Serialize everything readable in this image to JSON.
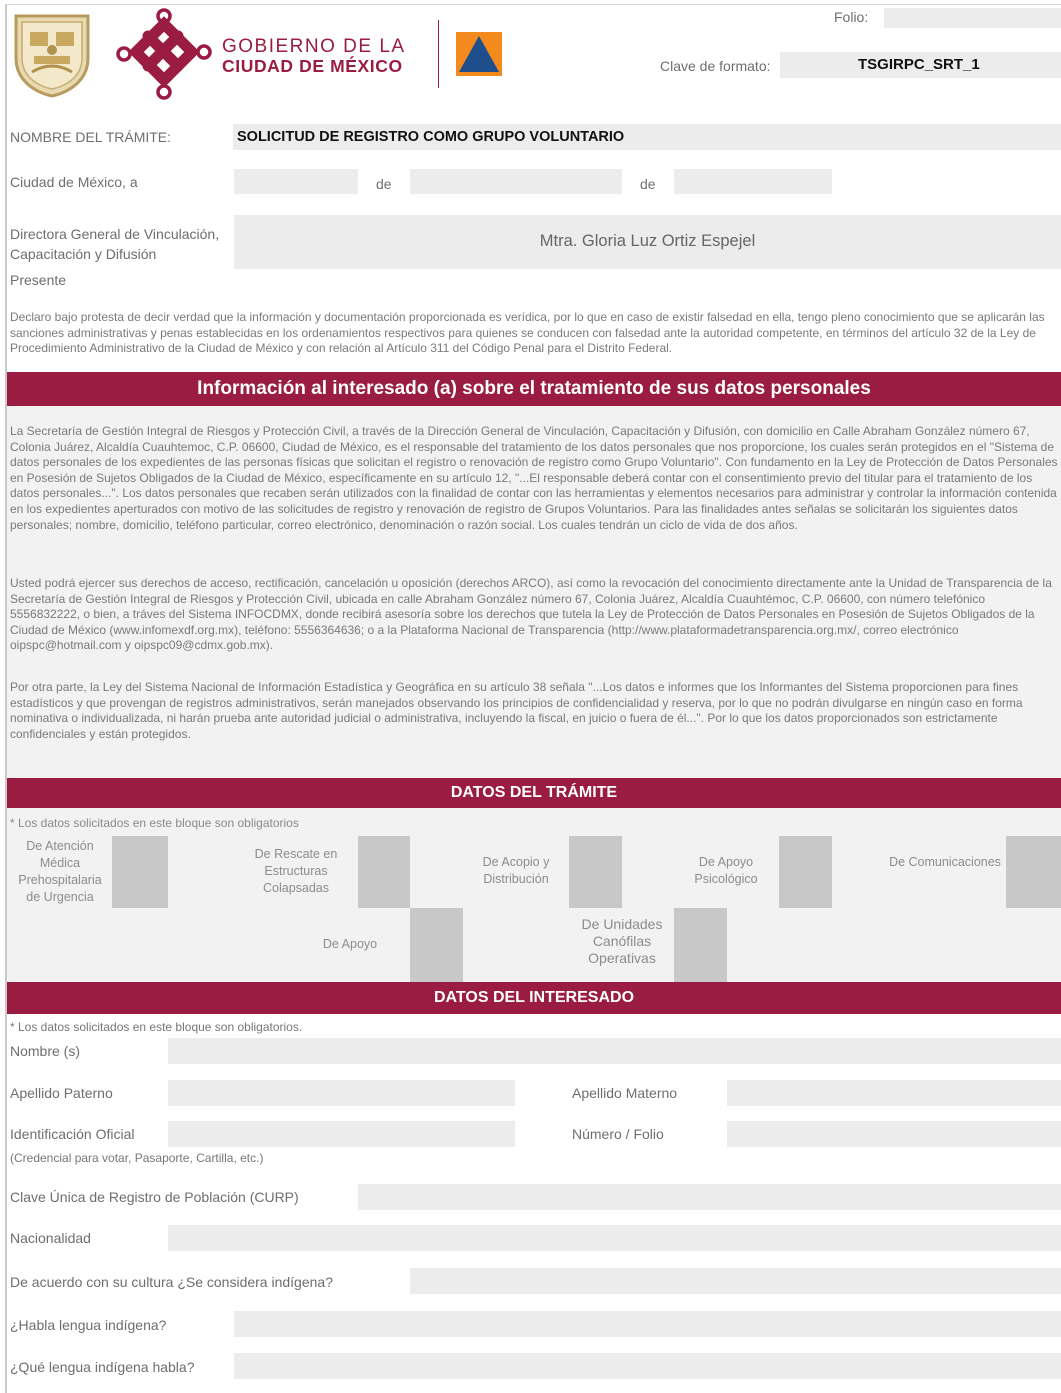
{
  "header": {
    "folio_label": "Folio:",
    "brand_line1": "GOBIERNO DE LA",
    "brand_line2": "CIUDAD DE MÉXICO",
    "clave_label": "Clave de formato:",
    "clave_value": "TSGIRPC_SRT_1",
    "colors": {
      "brand": "#9b1c42",
      "banner": "#9b1c42",
      "civil_protection_blue": "#1f4e8c",
      "civil_protection_orange": "#f28a1e"
    }
  },
  "tramite": {
    "nombre_label": "NOMBRE DEL TRÁMITE:",
    "nombre_value": "SOLICITUD DE REGISTRO COMO GRUPO VOLUNTARIO",
    "ciudad_label": "Ciudad de México, a",
    "de1": "de",
    "de2": "de",
    "directora_label": "Directora General de Vinculación, Capacitación y Difusión",
    "directora_value": "Mtra. Gloria Luz Ortiz Espejel",
    "presente": "Presente",
    "declaro": "Declaro bajo protesta de decir verdad que la información y documentación proporcionada es verídica, por lo que en caso de existir falsedad en ella, tengo pleno conocimiento que se aplicarán las sanciones administrativas y penas establecidas en los ordenamientos respectivos para quienes se conducen con falsedad ante la autoridad competente, en términos del artículo 32 de la Ley de Procedimiento Administrativo de la Ciudad de México y con relación al Artículo 311 del Código Penal para el Distrito Federal."
  },
  "info": {
    "title": "Información al interesado (a) sobre el tratamiento de sus datos personales",
    "p1": "La Secretaría de Gestión Integral de Riesgos y Protección Civil, a través de la Dirección General de Vinculación, Capacitación y Difusión, con domicilio en Calle Abraham González número 67, Colonia Juárez, Alcaldía Cuauhtemoc, C.P. 06600, Ciudad de México, es el responsable del tratamiento de los datos personales que nos proporcione, los cuales serán protegidos en el \"Sistema de datos personales de los expedientes de las personas físicas que solicitan el registro o renovación de registro como Grupo Voluntario\". Con fundamento en la Ley de Protección de Datos Personales en Posesión de Sujetos Obligados de la Ciudad de México, específicamente en su artículo 12, \"...El responsable deberá contar con el consentimiento previo del titular para el tratamiento de los datos personales...\". Los datos personales que recaben serán utilizados con la finalidad de contar con las herramientas y elementos necesarios para administrar y controlar la información contenida en los expedientes aperturados con motivo de las solicitudes de registro y renovación de registro de Grupos Voluntarios. Para las finalidades antes señalas se solicitarán los siguientes datos personales; nombre, domicilio, teléfono particular, correo electrónico, denominación o razón social. Los cuales tendrán un ciclo de vida de dos años.",
    "p2": "Usted podrá ejercer sus derechos de acceso, rectificación, cancelación u oposición (derechos ARCO), así como la revocación del conocimiento directamente ante la Unidad de Transparencia de la Secretaría de Gestión Integral de Riesgos y Protección Civil, ubicada en calle Abraham González número 67, Colonia Juárez, Alcaldía Cuauhtémoc, C.P. 06600, con número telefónico 5556832222, o bien, a tráves del Sistema INFOCDMX, donde recibirá asesoría sobre los derechos que tutela la Ley de Protección de Datos Personales en Posesión de Sujetos Obligados de la Ciudad de México (www.infomexdf.org.mx), teléfono: 5556364636; o a la Plataforma Nacional de Transparencia (http://www.plataformadetransparencia.org.mx/, correo electrónico oipspc@hotmail.com y oipspc09@cdmx.gob.mx).",
    "p3": "Por otra parte, la Ley del Sistema Nacional de Información Estadística y Geográfica en su artículo 38 señala \"...Los datos e informes que los Informantes del Sistema proporcionen para fines estadísticos y que provengan de registros administrativos, serán manejados observando los principios de confidencialidad y reserva, por lo que no podrán divulgarse en ningún caso en forma nominativa o individualizada, ni harán prueba ante autoridad judicial o administrativa, incluyendo la  fiscal, en juicio o fuera de él...\". Por lo que los datos proporcionados son estrictamente confidenciales y están protegidos."
  },
  "datos_tramite": {
    "title": "DATOS DEL TRÁMITE",
    "note": "* Los datos solicitados en este bloque son obligatorios",
    "options": [
      "De Atención Médica Prehospitalaria de Urgencia",
      "De Rescate en Estructuras Colapsadas",
      "De Acopio y Distribución",
      "De Apoyo Psicológico",
      "De Comunicaciones",
      "De Apoyo",
      "De Unidades Canófilas Operativas"
    ]
  },
  "datos_interesado": {
    "title": "DATOS DEL INTERESADO",
    "note": "* Los datos solicitados en este bloque son obligatorios.",
    "nombre": "Nombre (s)",
    "apellido_paterno": "Apellido Paterno",
    "apellido_materno": "Apellido Materno",
    "identificacion": "Identificación Oficial",
    "numero_folio": "Número / Folio",
    "identificacion_note": "(Credencial para votar, Pasaporte, Cartilla, etc.)",
    "curp": "Clave Única de Registro de Población (CURP)",
    "nacionalidad": "Nacionalidad",
    "indigena": "De acuerdo con su cultura ¿Se considera indígena?",
    "habla_lengua": "¿Habla lengua indígena?",
    "que_lengua": "¿Qué lengua indígena habla?"
  }
}
